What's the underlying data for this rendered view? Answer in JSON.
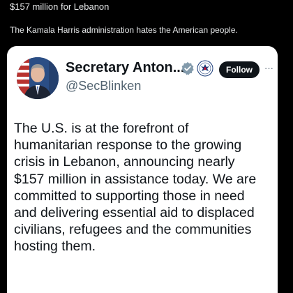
{
  "post": {
    "title": "$157 million for Lebanon",
    "text": "The Kamala Harris administration hates the American people."
  },
  "quoted_tweet": {
    "author_name": "Secretary Anton...",
    "handle": "@SecBlinken",
    "follow_label": "Follow",
    "more_label": "···",
    "body_lines": [
      "The U.S. is at the forefront of",
      "humanitarian response to the growing",
      "crisis in Lebanon, announcing nearly",
      "$157 million in assistance today. We are",
      "committed to supporting those in need",
      "and delivering essential aid to displaced",
      "civilians, refugees and the communities",
      "hosting them."
    ]
  },
  "icons": {
    "verified": "verified-gray-badge-icon",
    "seal": "state-department-seal-icon",
    "more": "more-options-icon"
  },
  "colors": {
    "background": "#000000",
    "card": "#ffffff",
    "primary_text": "#0f1419",
    "secondary_text": "#536471",
    "follow_button": "#0f1419"
  }
}
